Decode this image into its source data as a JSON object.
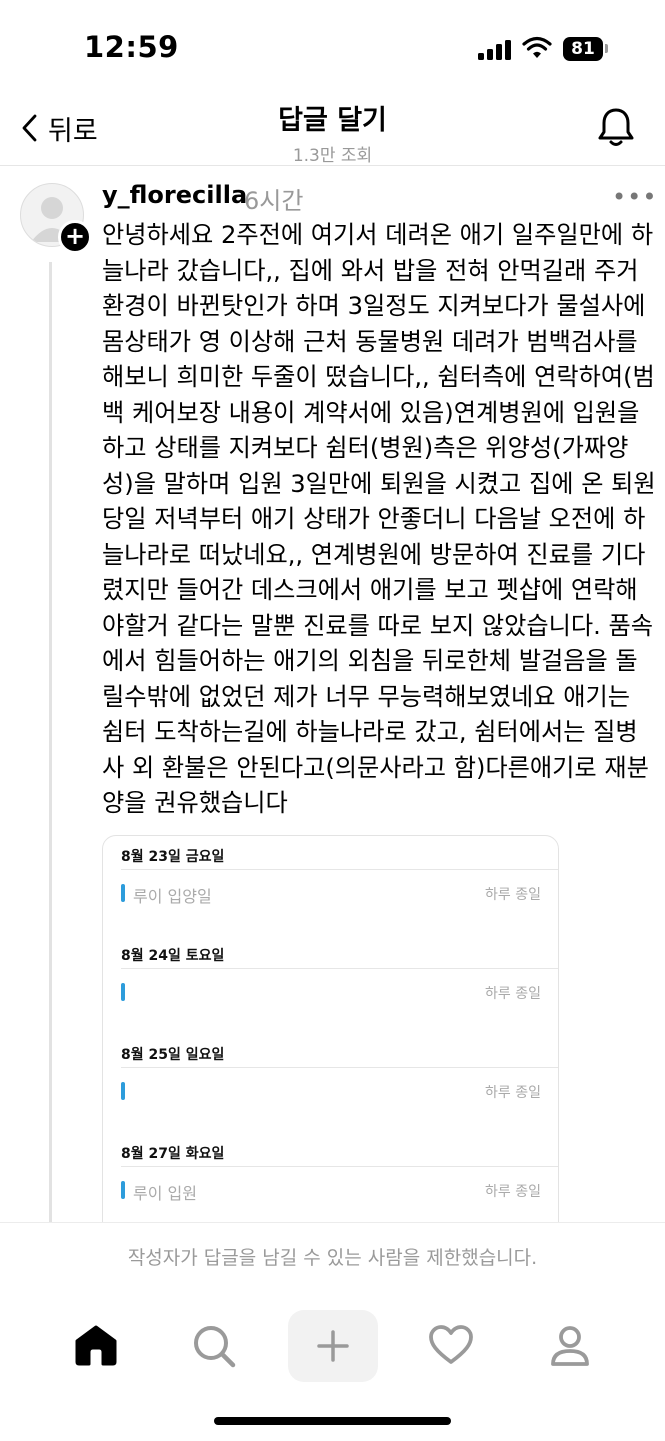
{
  "status_bar": {
    "time": "12:59",
    "battery": "81"
  },
  "nav": {
    "back_label": "뒤로",
    "title": "답글 달기",
    "views": "1.3만 조회"
  },
  "post": {
    "username": "y_florecilla",
    "time": "6시간",
    "more": "•••",
    "lines": [
      "안녕하세요 2주전에 여기서 데려온 애기 일주일만에 하",
      "늘나라 갔습니다,, 집에 와서 밥을 전혀 안먹길래 주거",
      "환경이 바뀐탓인가 하며 3일정도 지켜보다가 물설사에",
      "몸상태가 영 이상해 근처 동물병원 데려가 범백검사를",
      "해보니 희미한 두줄이 떴습니다,, 쉼터측에 연락하여(범",
      "백 케어보장 내용이 계약서에 있음)연계병원에 입원을",
      "하고 상태를 지켜보다 쉼터(병원)측은 위양성(가짜양",
      "성)을 말하며 입원 3일만에 퇴원을 시켰고 집에 온 퇴원",
      "당일 저녁부터 애기 상태가 안좋더니 다음날 오전에 하",
      "늘나라로 떠났네요,, 연계병원에 방문하여 진료를 기다",
      "렸지만 들어간 데스크에서 애기를 보고 펫샵에 연락해",
      "야할거 같다는 말뿐 진료를 따로 보지 않았습니다. 품속",
      "에서 힘들어하는 애기의 외침을 뒤로한체 발걸음을 돌",
      "릴수밖에 없었던 제가 너무 무능력해보였네요 애기는",
      "쉼터 도착하는길에 하늘나라로 갔고, 쉼터에서는 질병",
      "사 외 환불은 안된다고(의문사라고 함)다른애기로 재분",
      "양을 권유했습니다"
    ]
  },
  "calendar": {
    "days": [
      {
        "date": "8월 23일 금요일",
        "event": "루이 입양일",
        "time": "하루 종일"
      },
      {
        "date": "8월 24일 토요일",
        "event": "",
        "time": "하루 종일"
      },
      {
        "date": "8월 25일 일요일",
        "event": "",
        "time": "하루 종일"
      },
      {
        "date": "8월 27일 화요일",
        "event": "루이 입원",
        "time": "하루 종일"
      }
    ],
    "accent": "#2d9cdb"
  },
  "footer": {
    "restriction": "작성자가 답글을 남길 수 있는 사람을 제한했습니다."
  },
  "tabs": [
    "home-icon",
    "search-icon",
    "plus-icon",
    "heart-icon",
    "profile-icon"
  ]
}
